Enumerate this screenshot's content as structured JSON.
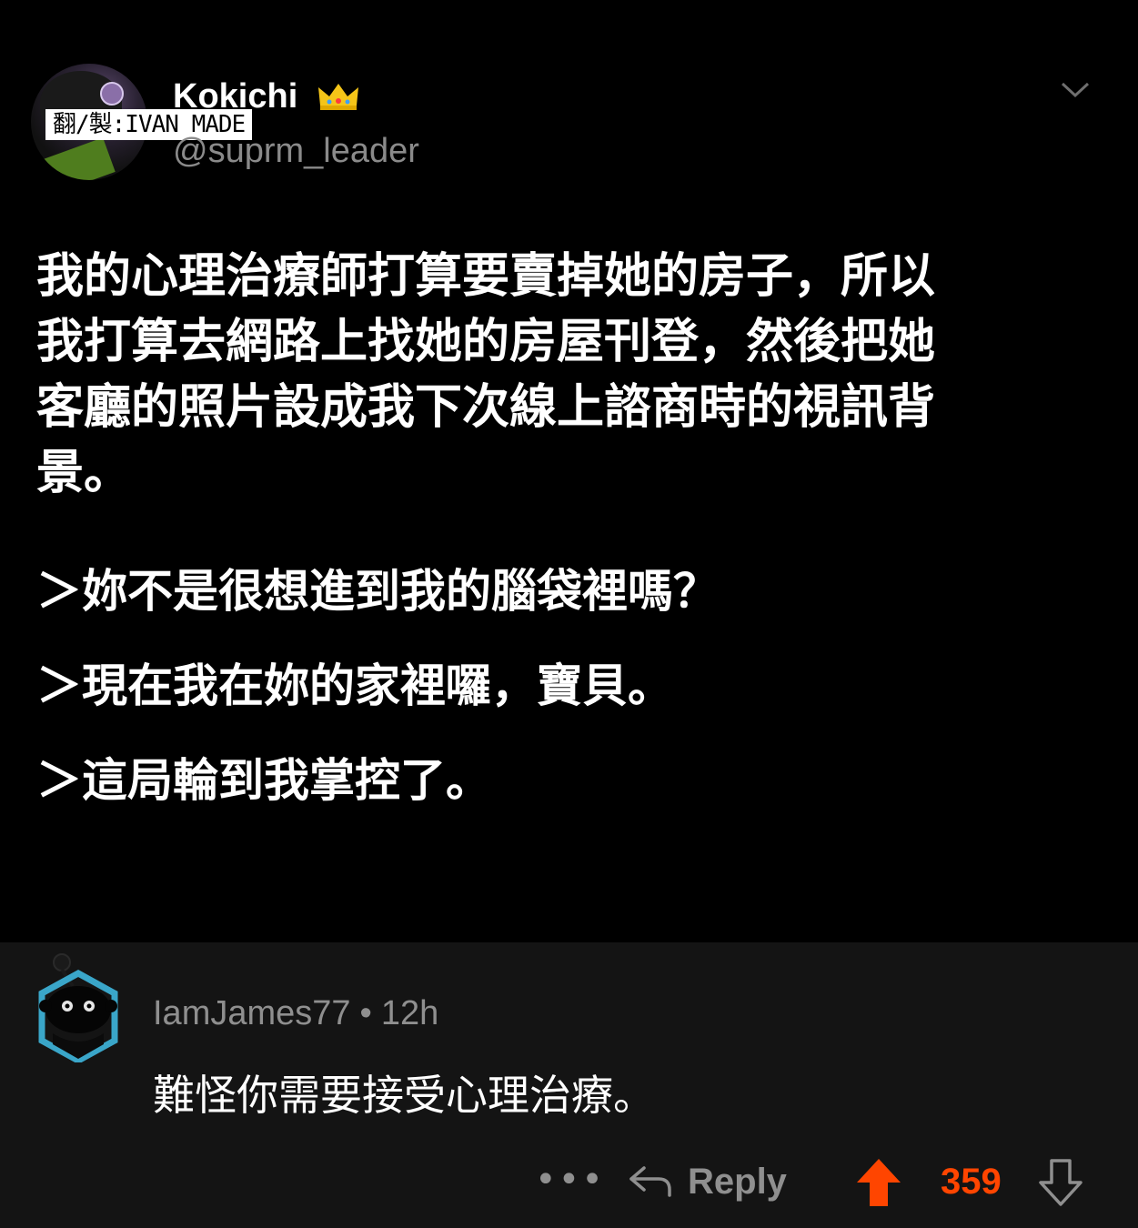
{
  "tweet": {
    "display_name": "Kokichi",
    "handle": "@suprm_leader",
    "credit": "翻/製:IVAN MADE",
    "body_lines": [
      "我的心理治療師打算要賣掉她的房子，所以",
      "我打算去網路上找她的房屋刊登，然後把她",
      "客廳的照片設成我下次線上諮商時的視訊背",
      "景。"
    ],
    "quotes": [
      "＞妳不是很想進到我的腦袋裡嗎？",
      "＞現在我在妳的家裡囉，寶貝。",
      "＞這局輪到我掌控了。"
    ]
  },
  "comment": {
    "username": "IamJames77",
    "separator": "•",
    "time": "12h",
    "text": "難怪你需要接受心理治療。",
    "more_label": "•••",
    "reply_label": "Reply",
    "score": "359"
  },
  "colors": {
    "background": "#000000",
    "comment_background": "#141414",
    "muted_text": "#8f8f8f",
    "upvote": "#ff4500"
  }
}
